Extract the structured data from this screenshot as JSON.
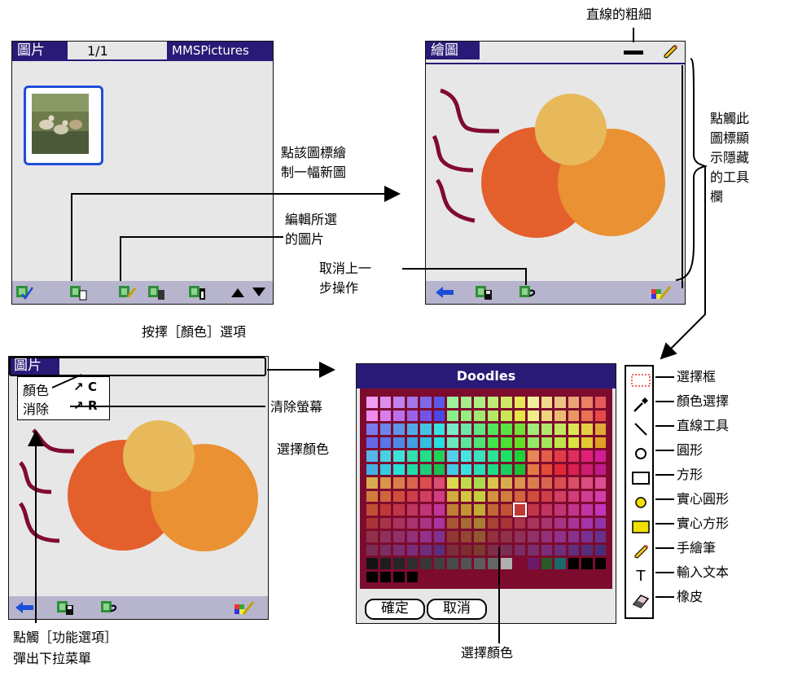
{
  "colors": {
    "accent": "#2a1a78",
    "bar": "#b7b5cd",
    "panel": "#e7e7e7",
    "palette_frame": "#7d0b2e",
    "stroke": "#800a32",
    "c_dark": "#e3602d",
    "c_mid": "#ea9133",
    "c_light": "#e7b95a"
  },
  "screen_pictures": {
    "tab_label": "圖片",
    "page_count": "1/1",
    "app_name": "MMSPictures",
    "thumbnail_icon": "photo-thumbnail-icon",
    "toolbar_icons": [
      "select-all-icon",
      "new-picture-icon",
      "edit-picture-icon",
      "delete-picture-icon",
      "info-icon",
      "scroll-up-icon",
      "scroll-down-icon"
    ]
  },
  "screen_paint": {
    "tab_label": "繪圖",
    "line_width_icon": "line-width-icon",
    "pencil_icon": "pencil-icon",
    "toolbar_icons": [
      "back-arrow-icon",
      "save-icon",
      "undo-icon",
      "palette-toggle-icon"
    ]
  },
  "screen_menu": {
    "tab_label": "圖片",
    "menu_items": [
      {
        "label": "顏色",
        "shortcut": "C"
      },
      {
        "label": "消除",
        "shortcut": "R"
      }
    ]
  },
  "palette_dialog": {
    "title": "Doodles",
    "ok_label": "確定",
    "cancel_label": "取消"
  },
  "tools": [
    {
      "icon": "selection-box-icon",
      "label": "選擇框"
    },
    {
      "icon": "eyedropper-icon",
      "label": "顏色選擇"
    },
    {
      "icon": "line-tool-icon",
      "label": "直線工具"
    },
    {
      "icon": "circle-icon",
      "label": "圓形"
    },
    {
      "icon": "rectangle-icon",
      "label": "方形"
    },
    {
      "icon": "filled-circle-icon",
      "label": "實心圓形"
    },
    {
      "icon": "filled-rectangle-icon",
      "label": "實心方形"
    },
    {
      "icon": "freehand-pen-icon",
      "label": "手繪筆"
    },
    {
      "icon": "text-tool-icon",
      "label": "輸入文本"
    },
    {
      "icon": "eraser-icon",
      "label": "橡皮"
    }
  ],
  "annotations": {
    "line_width": "直線的粗細",
    "show_toolbar": [
      "點觸此",
      "圖標顯",
      "示隱藏",
      "的工具",
      "欄"
    ],
    "new_picture": [
      "點該圖標繪",
      "制一幅新圖"
    ],
    "edit_picture": [
      "編輯所選",
      "的圖片"
    ],
    "undo": [
      "取消上一",
      "步操作"
    ],
    "choose_color_option": "按擇［顏色］選項",
    "clear_screen": "清除螢幕",
    "choose_color_left": "選擇顏色",
    "choose_color_bottom": "選擇顏色",
    "menu_popup": [
      "點觸［功能選項］",
      "彈出下拉菜單"
    ]
  }
}
